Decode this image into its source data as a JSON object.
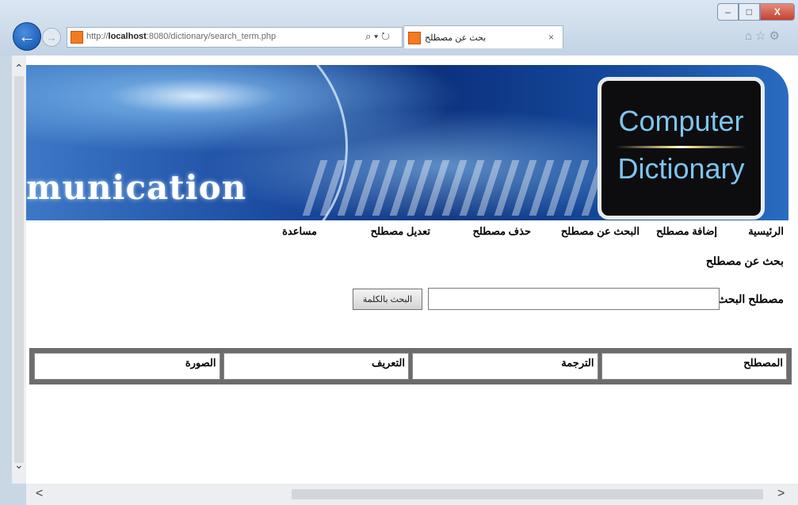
{
  "browser": {
    "url_prefix": "http://",
    "url_host": "localhost",
    "url_rest": ":8080/dictionary/search_term.php",
    "address_tools": "⌕ ▾ ↻",
    "tab_title": "بحث عن مصطلح",
    "tab_close": "×",
    "window_controls": {
      "minimize": "–",
      "maximize": "□",
      "close": "X"
    },
    "toolbar_icons": "⌂☆⚙"
  },
  "banner": {
    "word": "munication",
    "logo_line1": "Computer",
    "logo_line2": "Dictionary"
  },
  "nav": {
    "home": "الرئيسية",
    "add_term": "إضافة مصطلح",
    "search_term": "البحث عن مصطلح",
    "delete_term": "حذف مصطلح",
    "edit_term": "تعديل مصطلح",
    "help": "مساعدة"
  },
  "page": {
    "title": "بحث عن مصطلح",
    "search_label": "مصطلح البحث",
    "search_value": "",
    "search_button": "البحث بالكلمة"
  },
  "table": {
    "headers": [
      "المصطلح",
      "الترجمة",
      "التعريف",
      "الصورة"
    ]
  },
  "scrollbars": {
    "up": "⌃",
    "down": "⌄",
    "left": "<",
    "right": ">"
  }
}
